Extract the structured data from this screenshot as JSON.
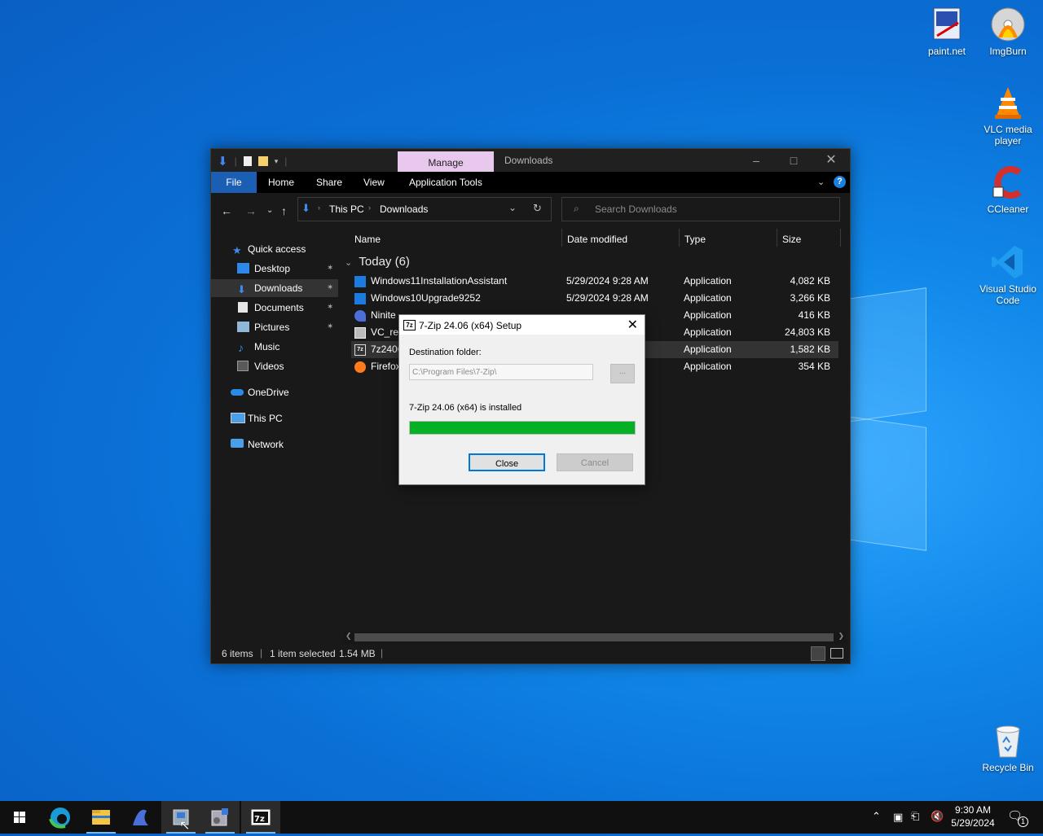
{
  "desktop": {
    "icons": [
      {
        "label": "paint.net",
        "icon": "paintnet-icon"
      },
      {
        "label": "ImgBurn",
        "icon": "imgburn-icon"
      },
      {
        "label": "VLC media player",
        "icon": "vlc-icon"
      },
      {
        "label": "CCleaner",
        "icon": "ccleaner-icon"
      },
      {
        "label": "Visual Studio Code",
        "icon": "vscode-icon"
      },
      {
        "label": "Recycle Bin",
        "icon": "recycle-bin-icon"
      }
    ]
  },
  "explorer": {
    "title": "Downloads",
    "context_tab": "Manage",
    "ribbon_tabs": [
      "File",
      "Home",
      "Share",
      "View",
      "Application Tools"
    ],
    "breadcrumb": [
      "This PC",
      "Downloads"
    ],
    "search_placeholder": "Search Downloads",
    "nav": {
      "quick_access": "Quick access",
      "items": [
        "Desktop",
        "Downloads",
        "Documents",
        "Pictures",
        "Music",
        "Videos"
      ],
      "onedrive": "OneDrive",
      "this_pc": "This PC",
      "network": "Network"
    },
    "columns": [
      "Name",
      "Date modified",
      "Type",
      "Size"
    ],
    "group": "Today (6)",
    "files": [
      {
        "name": "Windows11InstallationAssistant",
        "date": "5/29/2024 9:28 AM",
        "type": "Application",
        "size": "4,082 KB"
      },
      {
        "name": "Windows10Upgrade9252",
        "date": "5/29/2024 9:28 AM",
        "type": "Application",
        "size": "3,266 KB"
      },
      {
        "name": "Ninite",
        "date": "",
        "type": "Application",
        "size": "416 KB"
      },
      {
        "name": "VC_red",
        "date": "",
        "type": "Application",
        "size": "24,803 KB"
      },
      {
        "name": "7z2406",
        "date": "",
        "type": "Application",
        "size": "1,582 KB"
      },
      {
        "name": "Firefox",
        "date": "",
        "type": "Application",
        "size": "354 KB"
      }
    ],
    "status": {
      "items": "6 items",
      "selected": "1 item selected",
      "size": "1.54 MB"
    }
  },
  "dialog": {
    "title": "7-Zip 24.06 (x64) Setup",
    "dest_label": "Destination folder:",
    "dest_value": "C:\\Program Files\\7-Zip\\",
    "browse_label": "...",
    "status_text": "7-Zip 24.06 (x64) is installed",
    "progress_percent": 100,
    "close_label": "Close",
    "cancel_label": "Cancel"
  },
  "taskbar": {
    "time": "9:30 AM",
    "date": "5/29/2024",
    "notification_count": "1"
  }
}
